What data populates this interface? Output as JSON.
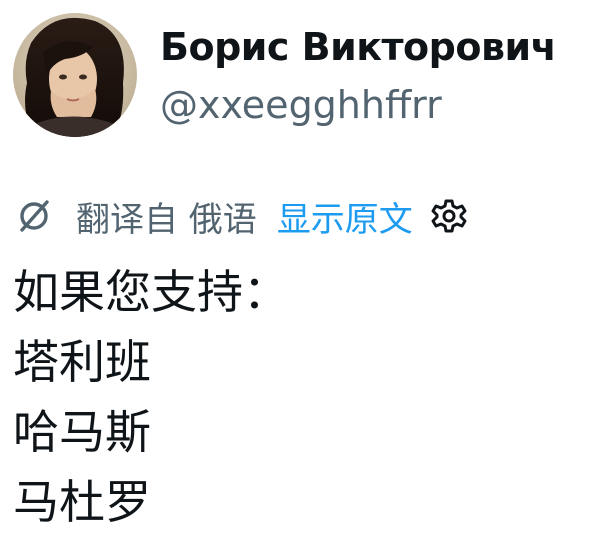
{
  "author": {
    "display_name": "Борис Викторович",
    "handle": "@xxeegghhffrr"
  },
  "translation_bar": {
    "translated_from": "翻译自 俄语",
    "show_original_label": "显示原文",
    "icons": [
      "globe-slash-icon",
      "gear-icon"
    ],
    "link_color": "#1d9bf0",
    "muted_color": "#536471"
  },
  "tweet": {
    "lines": [
      "如果您支持：",
      "塔利班",
      "哈马斯",
      "马杜罗"
    ]
  }
}
